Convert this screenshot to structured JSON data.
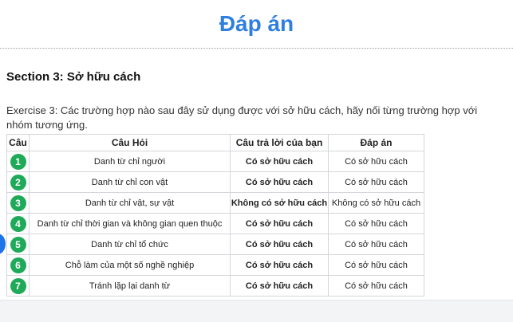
{
  "page": {
    "title": "Đáp án",
    "section_title": "Section 3: Sở hữu cách",
    "exercise_text": "Exercise 3: Các trường hợp nào sau đây sử dụng được với sở hữu cách, hãy nối từng trường hợp với nhóm tương ứng."
  },
  "table": {
    "headers": {
      "number": "Câu",
      "question": "Câu Hỏi",
      "your_answer": "Câu trả lời của bạn",
      "answer": "Đáp án"
    },
    "rows": [
      {
        "number": "1",
        "question": "Danh từ chỉ người",
        "your_answer": "Có sở hữu cách",
        "answer": "Có sở hữu cách"
      },
      {
        "number": "2",
        "question": "Danh từ chỉ con vật",
        "your_answer": "Có sở hữu cách",
        "answer": "Có sở hữu cách"
      },
      {
        "number": "3",
        "question": "Danh từ chỉ vật, sự vật",
        "your_answer": "Không có sở hữu cách",
        "answer": "Không có sở hữu cách"
      },
      {
        "number": "4",
        "question": "Danh từ chỉ thời gian và không gian quen thuộc",
        "your_answer": "Có sở hữu cách",
        "answer": "Có sở hữu cách"
      },
      {
        "number": "5",
        "question": "Danh từ chỉ tổ chức",
        "your_answer": "Có sở hữu cách",
        "answer": "Có sở hữu cách"
      },
      {
        "number": "6",
        "question": "Chỗ làm của một số nghề nghiệp",
        "your_answer": "Có sở hữu cách",
        "answer": "Có sở hữu cách"
      },
      {
        "number": "7",
        "question": "Tránh lặp lại danh từ",
        "your_answer": "Có sở hữu cách",
        "answer": "Có sở hữu cách"
      }
    ]
  },
  "colors": {
    "title_blue": "#2f7fe0",
    "badge_green": "#1faa59",
    "side_bubble_blue": "#1e73e8"
  }
}
